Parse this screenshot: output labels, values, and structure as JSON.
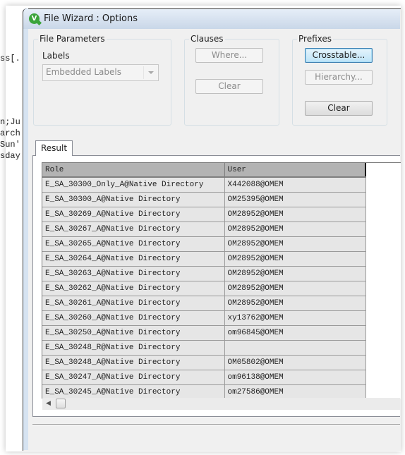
{
  "background_editor": {
    "lines": [
      "ss[.",
      "n;Ju",
      "arch",
      "Sun'",
      "sday"
    ]
  },
  "window": {
    "title": "File Wizard : Options",
    "app_icon": "qlikview-icon"
  },
  "file_parameters": {
    "group_label": "File Parameters",
    "labels_label": "Labels",
    "labels_select_value": "Embedded Labels"
  },
  "clauses": {
    "group_label": "Clauses",
    "where_button": "Where...",
    "clear_button": "Clear"
  },
  "prefixes": {
    "group_label": "Prefixes",
    "crosstable_button": "Crosstable...",
    "hierarchy_button": "Hierarchy...",
    "clear_button": "Clear"
  },
  "tabs": [
    {
      "label": "Result"
    }
  ],
  "result_table": {
    "columns": [
      "Role",
      "User"
    ],
    "rows": [
      [
        "E_SA_30300_Only_A@Native Directory",
        "X442088@OMEM"
      ],
      [
        "E_SA_30300_A@Native Directory",
        "OM25395@OMEM"
      ],
      [
        "E_SA_30269_A@Native Directory",
        "OM28952@OMEM"
      ],
      [
        "E_SA_30267_A@Native Directory",
        "OM28952@OMEM"
      ],
      [
        "E_SA_30265_A@Native Directory",
        "OM28952@OMEM"
      ],
      [
        "E_SA_30264_A@Native Directory",
        "OM28952@OMEM"
      ],
      [
        "E_SA_30263_A@Native Directory",
        "OM28952@OMEM"
      ],
      [
        "E_SA_30262_A@Native Directory",
        "OM28952@OMEM"
      ],
      [
        "E_SA_30261_A@Native Directory",
        "OM28952@OMEM"
      ],
      [
        "E_SA_30260_A@Native Directory",
        "xy13762@OMEM"
      ],
      [
        "E_SA_30250_A@Native Directory",
        "om96845@OMEM"
      ],
      [
        "E_SA_30248_R@Native Directory",
        ""
      ],
      [
        "E_SA_30248_A@Native Directory",
        "OM05802@OMEM"
      ],
      [
        "E_SA_30247_A@Native Directory",
        "om96138@OMEM"
      ],
      [
        "E_SA_30245_A@Native Directory",
        "om27586@OMEM"
      ]
    ]
  }
}
